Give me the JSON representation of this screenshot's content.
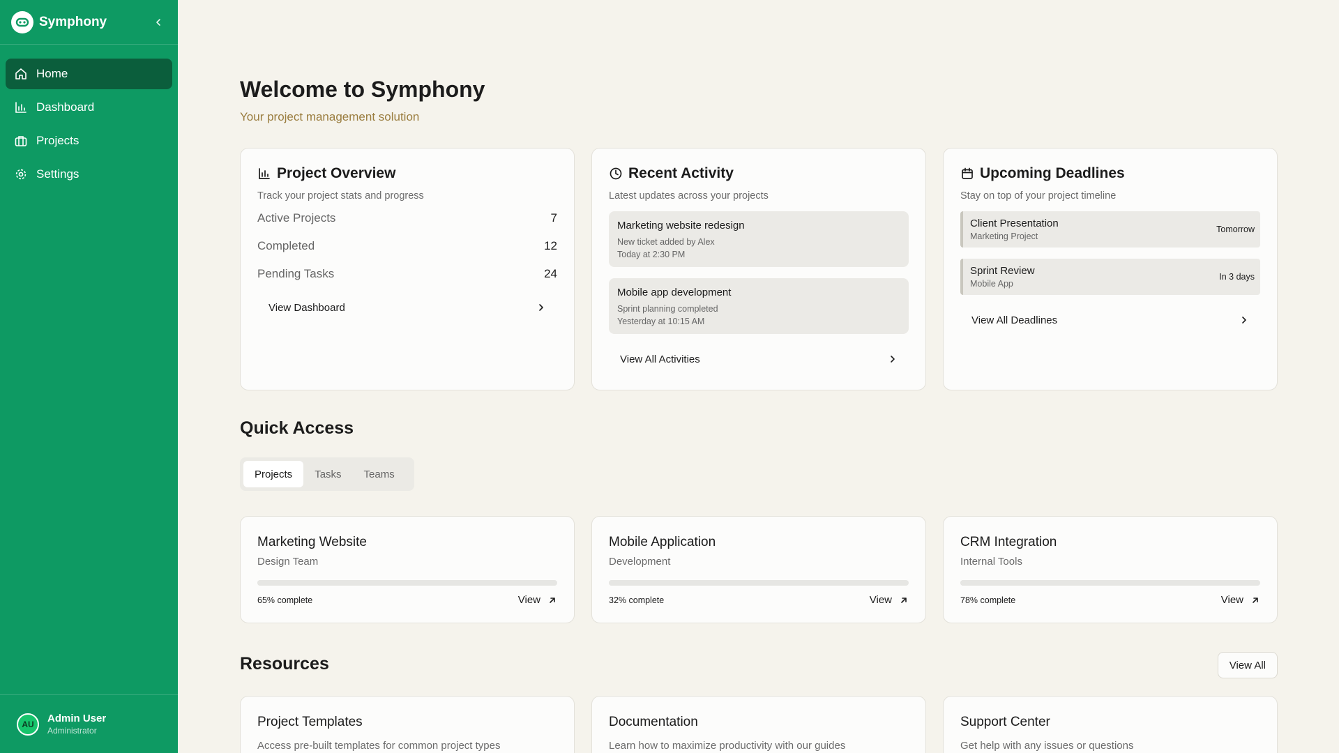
{
  "app": {
    "name": "Symphony"
  },
  "sidebar": {
    "items": [
      {
        "label": "Home",
        "icon": "home-icon",
        "active": true
      },
      {
        "label": "Dashboard",
        "icon": "bar-chart-icon",
        "active": false
      },
      {
        "label": "Projects",
        "icon": "briefcase-icon",
        "active": false
      },
      {
        "label": "Settings",
        "icon": "gear-icon",
        "active": false
      }
    ],
    "user": {
      "initials": "AU",
      "name": "Admin User",
      "role": "Administrator"
    }
  },
  "header": {
    "title": "Welcome to Symphony",
    "subtitle": "Your project management solution"
  },
  "overview": {
    "title": "Project Overview",
    "subtitle": "Track your project stats and progress",
    "rows": [
      {
        "label": "Active Projects",
        "value": "7"
      },
      {
        "label": "Completed",
        "value": "12"
      },
      {
        "label": "Pending Tasks",
        "value": "24"
      }
    ],
    "link": "View Dashboard"
  },
  "activity": {
    "title": "Recent Activity",
    "subtitle": "Latest updates across your projects",
    "items": [
      {
        "title": "Marketing website redesign",
        "detail": "New ticket added by Alex",
        "time": "Today at 2:30 PM"
      },
      {
        "title": "Mobile app development",
        "detail": "Sprint planning completed",
        "time": "Yesterday at 10:15 AM"
      }
    ],
    "link": "View All Activities"
  },
  "deadlines": {
    "title": "Upcoming Deadlines",
    "subtitle": "Stay on top of your project timeline",
    "items": [
      {
        "title": "Client Presentation",
        "project": "Marketing Project",
        "when": "Tomorrow"
      },
      {
        "title": "Sprint Review",
        "project": "Mobile App",
        "when": "In 3 days"
      }
    ],
    "link": "View All Deadlines"
  },
  "quick_access": {
    "title": "Quick Access",
    "tabs": [
      {
        "label": "Projects",
        "active": true
      },
      {
        "label": "Tasks",
        "active": false
      },
      {
        "label": "Teams",
        "active": false
      }
    ],
    "projects": [
      {
        "name": "Marketing Website",
        "team": "Design Team",
        "progress": 0.65,
        "progress_label": "65% complete",
        "view": "View"
      },
      {
        "name": "Mobile Application",
        "team": "Development",
        "progress": 0.32,
        "progress_label": "32% complete",
        "view": "View"
      },
      {
        "name": "CRM Integration",
        "team": "Internal Tools",
        "progress": 0.78,
        "progress_label": "78% complete",
        "view": "View"
      }
    ]
  },
  "resources": {
    "title": "Resources",
    "view_all": "View All",
    "items": [
      {
        "title": "Project Templates",
        "description": "Access pre-built templates for common project types"
      },
      {
        "title": "Documentation",
        "description": "Learn how to maximize productivity with our guides"
      },
      {
        "title": "Support Center",
        "description": "Get help with any issues or questions"
      }
    ]
  },
  "colors": {
    "brand": "#0e9a63",
    "nav_active": "#0b5e3c",
    "background": "#f5f3ec",
    "subtitle": "#9a7d3f"
  }
}
